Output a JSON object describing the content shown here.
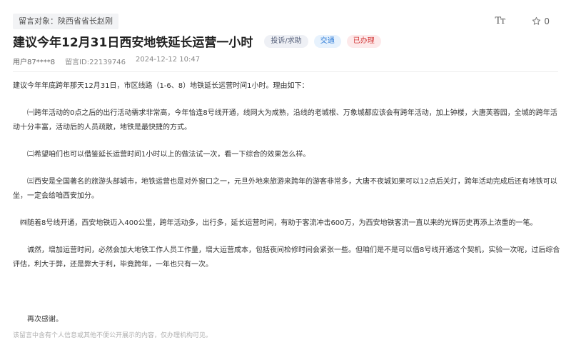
{
  "header": {
    "target_label": "留言对象：陕西省省长赵刚",
    "font_size_icon": "Tт",
    "favorite_count": "0"
  },
  "post": {
    "title": "建议今年12月31日西安地铁延长运营一小时",
    "tags": {
      "type": "投诉/求助",
      "category": "交通",
      "status": "已办理"
    },
    "meta": {
      "user": "用户87****8",
      "id": "留言ID:22139746",
      "time": "2024-12-12 10:47"
    },
    "paragraphs": [
      "建议今年年底跨年那天12月31日，市区线路（1-6、8）地铁延长运营时间1小时。理由如下：",
      "　　㈠跨年活动的0点之后的出行活动需求非常高，今年恰逢8号线开通，线网大为成熟，沿线的老城根、万象城都应该会有跨年活动，加上钟楼，大唐芙蓉园，全城的跨年活动十分丰富，活动后的人员疏散，地铁是最快捷的方式。",
      "　　㈡希望咱们也可以借鉴延长运营时间1小时以上的做法试一次，看一下综合的效果怎么样。",
      "　　㈢西安是全国著名的旅游头部城市，地铁运营也是对外窗口之一，元旦外地来旅游来跨年的游客非常多，大唐不夜城如果可以12点后关灯，跨年活动完成后还有地铁可以坐，一定会给咱西安加分。",
      "　㈣随着8号线开通，西安地铁迈入400公里，跨年活动多，出行多，延长运营时间，有助于客流冲击600万，为西安地铁客流一直以来的光辉历史再添上浓重的一笔。",
      "　　诚然，增加运营时间，必然会加大地铁工作人员工作量，增大运营成本，包括夜间检修时间会紧张一些。但咱们是不是可以借8号线开通这个契机，实验一次呢，过后综合评估，利大于弊，还是弊大于利，毕竟跨年，一年也只有一次。",
      "　　再次感谢。"
    ],
    "footnote": "该留言中含有个人信息或其他不便公开展示的内容，仅办理机构可见。"
  },
  "colors": {
    "tag_category": "#2e7bd6",
    "tag_status": "#d23a3a"
  }
}
